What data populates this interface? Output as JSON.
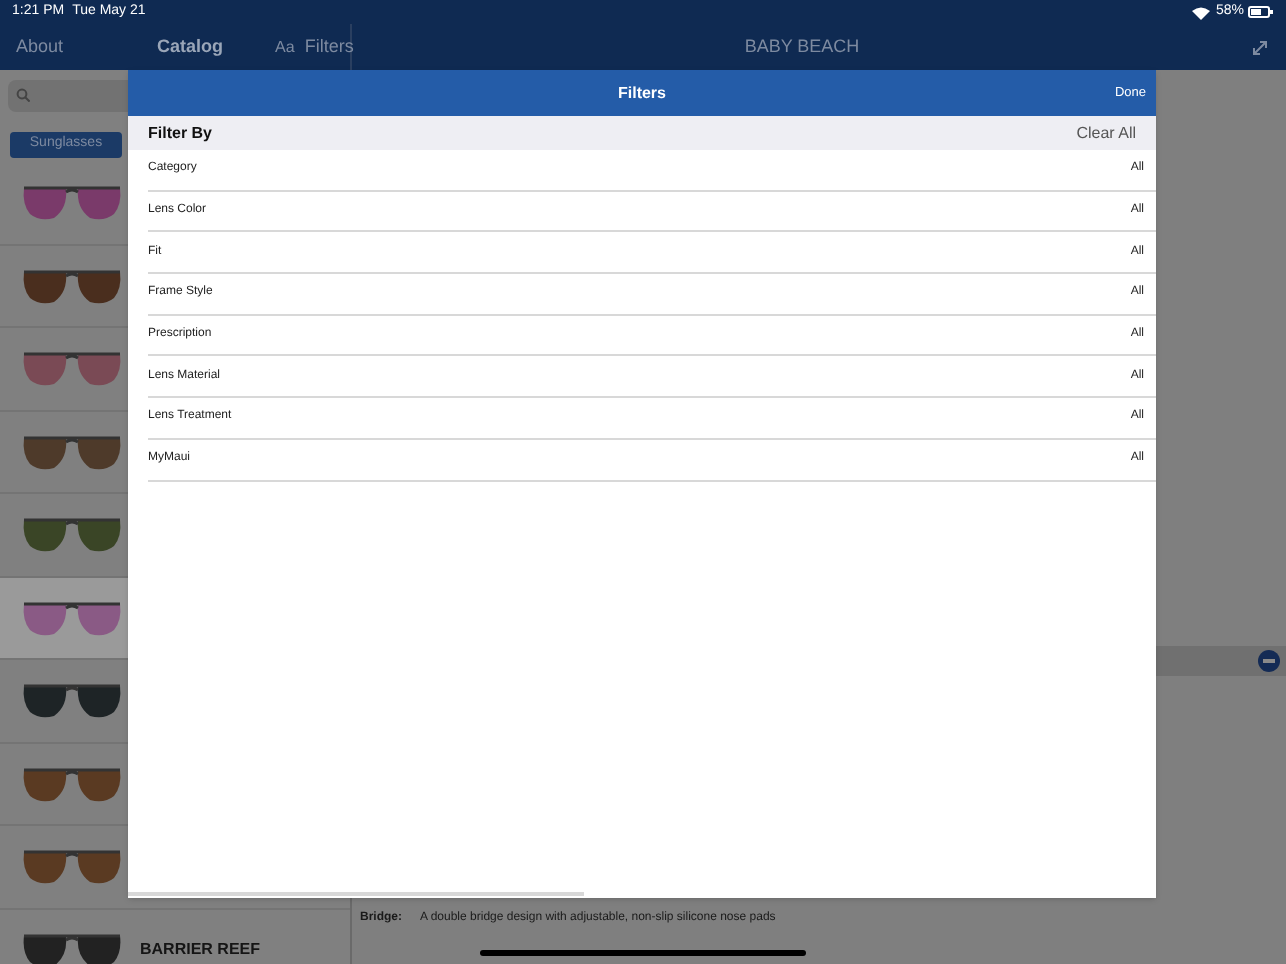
{
  "status_bar": {
    "time": "1:21 PM",
    "date": "Tue May 21",
    "battery": "58%"
  },
  "nav": {
    "about": "About",
    "catalog": "Catalog",
    "font_button": "Aa",
    "filters": "Filters",
    "title": "BABY BEACH"
  },
  "sidebar": {
    "segment": "Sunglasses",
    "products": [
      {
        "color": "#7a3a6a",
        "selected": false
      },
      {
        "color": "#4a2e1e",
        "selected": false
      },
      {
        "color": "#7a4a55",
        "selected": false
      },
      {
        "color": "#4e3a2a",
        "selected": false
      },
      {
        "color": "#3a4526",
        "selected": false
      },
      {
        "color": "#8a5a85",
        "selected": true
      },
      {
        "color": "#1e2426",
        "selected": false
      },
      {
        "color": "#5a3a22",
        "selected": false
      },
      {
        "color": "#5a3a22",
        "selected": false
      },
      {
        "color": "#222222",
        "selected": false,
        "name": "BARRIER REEF"
      }
    ]
  },
  "detail": {
    "bridge_label": "Bridge:",
    "bridge_text": "A double bridge design with adjustable, non-slip silicone nose pads"
  },
  "modal": {
    "title": "Filters",
    "done": "Done",
    "section": "Filter By",
    "clear_all": "Clear All",
    "filters": [
      {
        "label": "Category",
        "value": "All"
      },
      {
        "label": "Lens Color",
        "value": "All"
      },
      {
        "label": "Fit",
        "value": "All"
      },
      {
        "label": "Frame Style",
        "value": "All"
      },
      {
        "label": "Prescription",
        "value": "All"
      },
      {
        "label": "Lens Material",
        "value": "All"
      },
      {
        "label": "Lens Treatment",
        "value": "All"
      },
      {
        "label": "MyMaui",
        "value": "All"
      }
    ]
  }
}
